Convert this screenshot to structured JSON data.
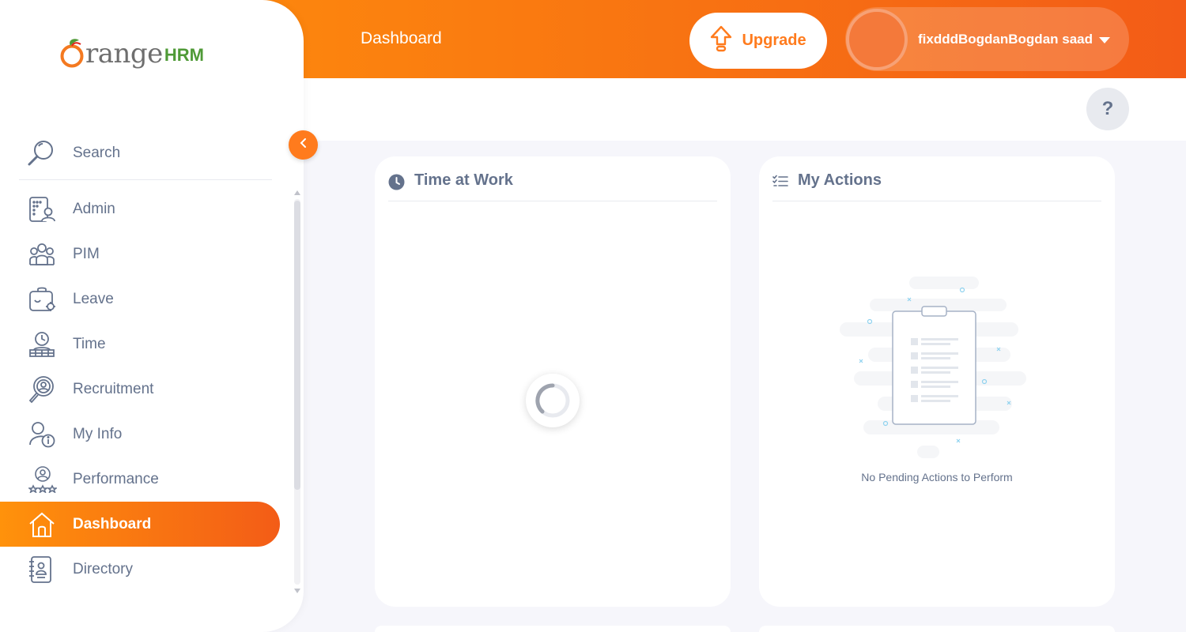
{
  "header": {
    "page_title": "Dashboard",
    "upgrade_label": "Upgrade",
    "user_name": "fixdddBogdanBogdan saad",
    "help_label": "?"
  },
  "brand": {
    "word": "range",
    "suffix": "HRM",
    "colors": {
      "accent": "#ff7b1d",
      "gradient_start": "#ff920b",
      "gradient_end": "#f35c17",
      "logo_green": "#4f9a37"
    }
  },
  "sidebar": {
    "search_placeholder": "Search",
    "items": [
      {
        "label": "Admin",
        "icon": "admin-icon",
        "active": false
      },
      {
        "label": "PIM",
        "icon": "pim-icon",
        "active": false
      },
      {
        "label": "Leave",
        "icon": "leave-icon",
        "active": false
      },
      {
        "label": "Time",
        "icon": "time-icon",
        "active": false
      },
      {
        "label": "Recruitment",
        "icon": "recruitment-icon",
        "active": false
      },
      {
        "label": "My Info",
        "icon": "my-info-icon",
        "active": false
      },
      {
        "label": "Performance",
        "icon": "performance-icon",
        "active": false
      },
      {
        "label": "Dashboard",
        "icon": "dashboard-icon",
        "active": true
      },
      {
        "label": "Directory",
        "icon": "directory-icon",
        "active": false
      }
    ]
  },
  "widgets": {
    "time_at_work": {
      "title": "Time at Work",
      "icon": "clock-icon"
    },
    "my_actions": {
      "title": "My Actions",
      "icon": "checklist-icon",
      "empty_message": "No Pending Actions to Perform"
    }
  }
}
